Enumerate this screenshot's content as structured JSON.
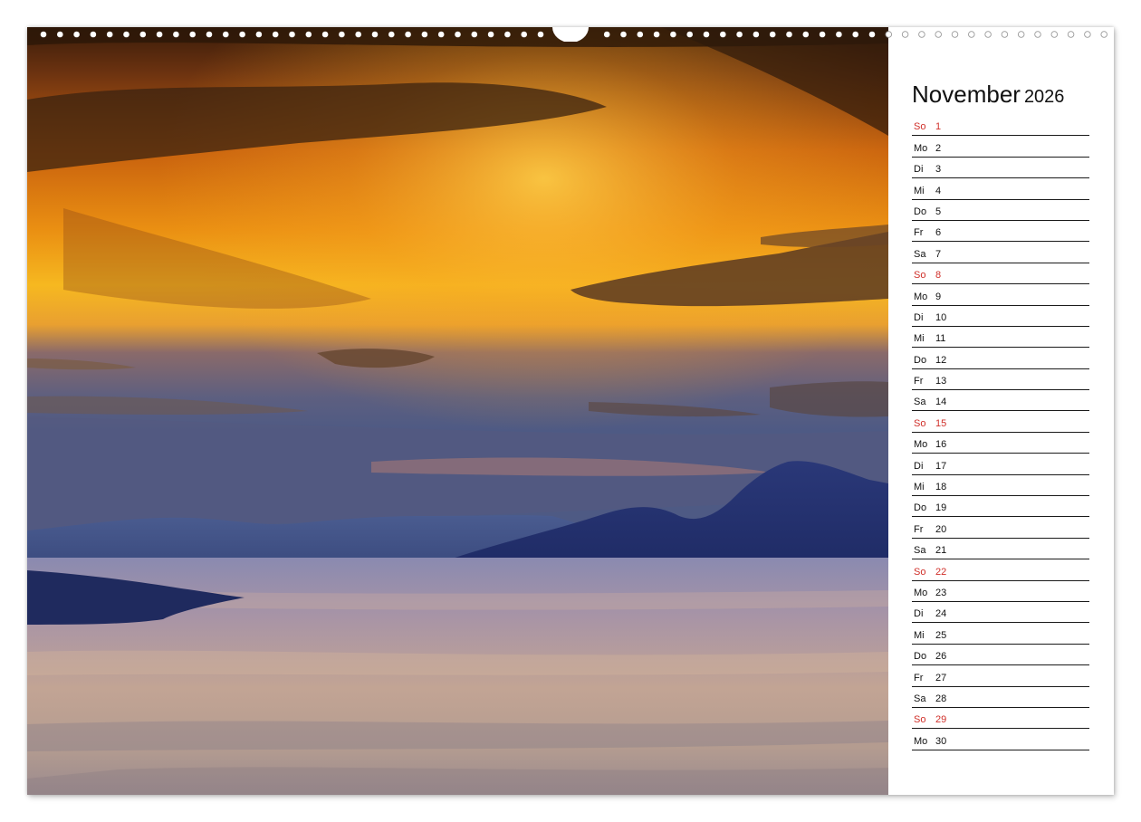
{
  "calendar": {
    "month": "November",
    "year": "2026",
    "sunday_color": "#d0302a",
    "days": [
      {
        "wd": "So",
        "d": "1",
        "sunday": true
      },
      {
        "wd": "Mo",
        "d": "2"
      },
      {
        "wd": "Di",
        "d": "3"
      },
      {
        "wd": "Mi",
        "d": "4"
      },
      {
        "wd": "Do",
        "d": "5"
      },
      {
        "wd": "Fr",
        "d": "6"
      },
      {
        "wd": "Sa",
        "d": "7"
      },
      {
        "wd": "So",
        "d": "8",
        "sunday": true
      },
      {
        "wd": "Mo",
        "d": "9"
      },
      {
        "wd": "Di",
        "d": "10"
      },
      {
        "wd": "Mi",
        "d": "11"
      },
      {
        "wd": "Do",
        "d": "12"
      },
      {
        "wd": "Fr",
        "d": "13"
      },
      {
        "wd": "Sa",
        "d": "14"
      },
      {
        "wd": "So",
        "d": "15",
        "sunday": true
      },
      {
        "wd": "Mo",
        "d": "16"
      },
      {
        "wd": "Di",
        "d": "17"
      },
      {
        "wd": "Mi",
        "d": "18"
      },
      {
        "wd": "Do",
        "d": "19"
      },
      {
        "wd": "Fr",
        "d": "20"
      },
      {
        "wd": "Sa",
        "d": "21"
      },
      {
        "wd": "So",
        "d": "22",
        "sunday": true
      },
      {
        "wd": "Mo",
        "d": "23"
      },
      {
        "wd": "Di",
        "d": "24"
      },
      {
        "wd": "Mi",
        "d": "25"
      },
      {
        "wd": "Do",
        "d": "26"
      },
      {
        "wd": "Fr",
        "d": "27"
      },
      {
        "wd": "Sa",
        "d": "28"
      },
      {
        "wd": "So",
        "d": "29",
        "sunday": true
      },
      {
        "wd": "Mo",
        "d": "30"
      }
    ]
  },
  "photo": {
    "subject": "sunset-over-sea-and-mountains-illustration"
  }
}
